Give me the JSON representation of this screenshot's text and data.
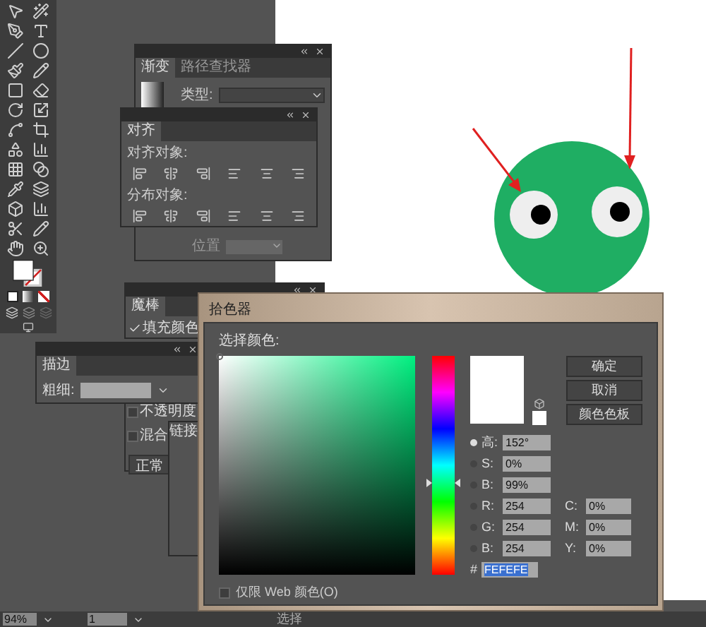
{
  "gradient_panel": {
    "tabs": [
      {
        "label": "渐变",
        "selected": true
      },
      {
        "label": "路径查找器",
        "selected": false
      }
    ],
    "type_label": "类型:",
    "position_label": "位置"
  },
  "align_panel": {
    "tabs": [
      {
        "label": "对齐",
        "selected": true
      }
    ],
    "align_label": "对齐对象:",
    "distribute_label": "分布对象:"
  },
  "magic_wand_panel": {
    "tabs": [
      {
        "label": "魔棒",
        "selected": true
      }
    ],
    "options": [
      {
        "label": "填充颜色",
        "checked": true
      }
    ]
  },
  "stroke_panel": {
    "tabs": [
      {
        "label": "描边",
        "selected": true
      }
    ],
    "weight_label": "粗细:"
  },
  "transparency_panel": {
    "options": [
      {
        "label": "不透明度",
        "checked": false
      },
      {
        "label": "混合",
        "checked": false
      }
    ],
    "mode": "正常"
  },
  "links_panel": {
    "tabs": [
      {
        "label": "链接",
        "selected": true
      }
    ]
  },
  "color_picker": {
    "title": "拾色器",
    "select_label": "选择颜色:",
    "buttons": [
      "确定",
      "取消",
      "颜色色板"
    ],
    "hsb": [
      {
        "label": "高:",
        "value": "152°",
        "selected": true
      },
      {
        "label": "S:",
        "value": "0%",
        "selected": false
      },
      {
        "label": "B:",
        "value": "99%",
        "selected": false
      }
    ],
    "rgb": [
      {
        "label": "R:",
        "value": "254",
        "selected": false
      },
      {
        "label": "G:",
        "value": "254",
        "selected": false
      },
      {
        "label": "B:",
        "value": "254",
        "selected": false
      }
    ],
    "cmyk": [
      {
        "label": "C:",
        "value": "0%"
      },
      {
        "label": "M:",
        "value": "0%"
      },
      {
        "label": "Y:",
        "value": "0%"
      }
    ],
    "hex_label": "#",
    "hex": "FEFEFE",
    "web_only": {
      "label": "仅限 Web 颜色(O)",
      "checked": false
    }
  },
  "status_bar": {
    "zoom": "94%",
    "artboard": "1",
    "tool": "选择"
  }
}
